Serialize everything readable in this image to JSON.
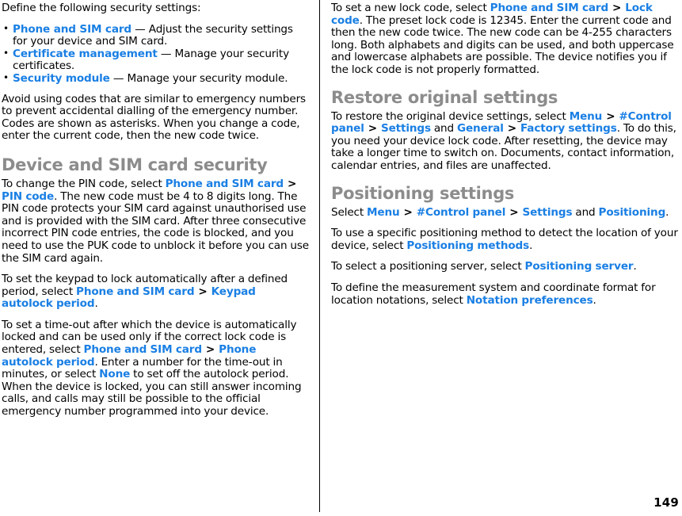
{
  "document": {
    "page_number": "149",
    "accent_link_color": "#1a7fe4",
    "heading_color": "#8c8c8c",
    "body_color": "#000000"
  },
  "left_column": {
    "intro": "Define the following security settings:",
    "bullets": [
      {
        "term": "Phone and SIM card",
        "dash": "—",
        "desc": "Adjust the security settings for your device and SIM card."
      },
      {
        "term": "Certificate management",
        "dash": "—",
        "desc": "Manage your security certificates."
      },
      {
        "term": "Security module",
        "dash": "—",
        "desc": "Manage your security module."
      }
    ],
    "paragraph_avoid": "Avoid using codes that are similar to emergency numbers to prevent accidental dialling of the emergency number. Codes are shown as asterisks. When you change a code, enter the current code, then the new code twice.",
    "heading_device_sim": "Device and SIM card security",
    "pin": {
      "p1": "To change the PIN code, select ",
      "link1": "Phone and SIM card",
      "sep1": ">",
      "link2": "PIN code",
      "p2": ". The new code must be 4 to 8 digits long. The PIN code protects your SIM card against unauthorised use and is provided with the SIM card. After three consecutive incorrect PIN code entries, the code is blocked, and you need to use the PUK code to unblock it before you can use the SIM card again."
    },
    "keypad": {
      "p1": "To set the keypad to lock automatically after a defined period, select ",
      "link1": "Phone and SIM card",
      "sep1": ">",
      "link2": "Keypad autolock period",
      "p2": "."
    },
    "timeout": {
      "p1": "To set a time-out after which the device is automatically locked and can be used only if the correct lock code is entered, select ",
      "link1": "Phone and SIM card",
      "sep1": ">",
      "link2": "Phone autolock period",
      "p2": ". Enter a number for the time-out in minutes, or select ",
      "link3": "None",
      "p3": " to set off the autolock period. When the device is locked, you can still answer incoming calls, and calls may still be possible to the official emergency number programmed into your device."
    }
  },
  "right_column": {
    "lockcode": {
      "p1": "To set a new lock code, select ",
      "link1": "Phone and SIM card",
      "sep1": ">",
      "link2": "Lock code",
      "p2": ". The preset lock code is 12345. Enter the current code and then the new code twice. The new code can be 4-255 characters long. Both alphabets and digits can be used, and both uppercase and lowercase alphabets are possible. The device notifies you if the lock code is not properly formatted."
    },
    "heading_restore": "Restore original settings",
    "restore": {
      "p1": "To restore the original device settings, select ",
      "link1": "Menu",
      "sep1": ">",
      "link2": "#Control panel",
      "sep2": ">",
      "link3": "Settings",
      "mid1": " and ",
      "link4": "General",
      "sep3": ">",
      "link5": "Factory settings",
      "p2": ". To do this, you need your device lock code. After resetting, the device may take a longer time to switch on. Documents, contact information, calendar entries, and files are unaffected."
    },
    "heading_positioning": "Positioning settings",
    "select_path": {
      "p1": "Select ",
      "link1": "Menu",
      "sep1": ">",
      "link2": "#Control panel",
      "sep2": ">",
      "link3": "Settings",
      "mid1": " and ",
      "link4": "Positioning",
      "p2": "."
    },
    "method": {
      "p1": "To use a specific positioning method to detect the location of your device, select ",
      "link1": "Positioning methods",
      "p2": "."
    },
    "server": {
      "p1": "To select a positioning server, select ",
      "link1": "Positioning server",
      "p2": "."
    },
    "notation": {
      "p1": "To define the measurement system and coordinate format for location notations, select ",
      "link1": "Notation preferences",
      "p2": "."
    }
  }
}
